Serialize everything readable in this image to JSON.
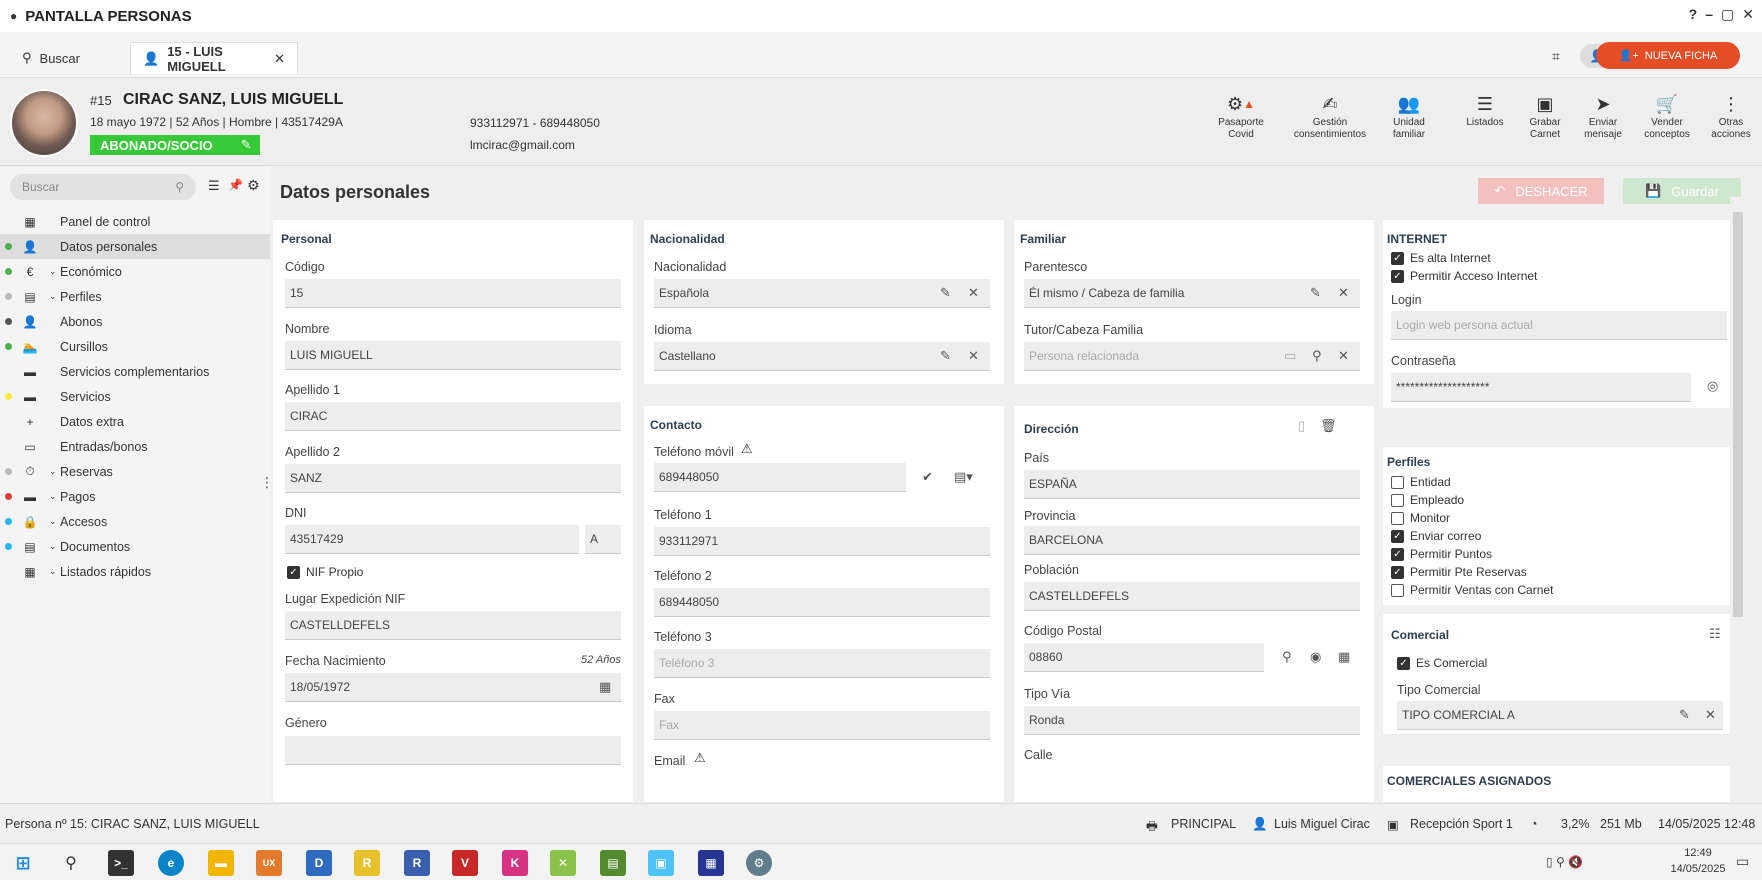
{
  "window": {
    "title": "PANTALLA PERSONAS",
    "controls": [
      "?",
      "–",
      "▢",
      "✕"
    ]
  },
  "tabs": {
    "search_label": "Buscar",
    "active_label": "15 - LUIS MIGUELL",
    "new_button": "NUEVA FICHA"
  },
  "person": {
    "number": "#15",
    "name": "CIRAC SANZ, LUIS MIGUELL",
    "details": "18 mayo 1972 | 52 Años | Hombre | 43517429A",
    "badge": "ABONADO/SOCIO",
    "phones": "933112971 - 689448050",
    "email": "lmcirac@gmail.com"
  },
  "header_actions": [
    {
      "label": "Pasaporte Covid",
      "icon": "gear-icon"
    },
    {
      "label": "Gestión consentimientos",
      "icon": "signature-icon"
    },
    {
      "label": "Unidad familiar",
      "icon": "family-icon"
    },
    {
      "label": "Listados",
      "icon": "list-icon"
    },
    {
      "label": "Grabar Carnet",
      "icon": "card-icon"
    },
    {
      "label": "Enviar mensaje",
      "icon": "send-icon"
    },
    {
      "label": "Vender conceptos",
      "icon": "sell-icon"
    },
    {
      "label": "Otras acciones",
      "icon": "more-icon"
    }
  ],
  "sidebar": {
    "search_placeholder": "Buscar",
    "items": [
      {
        "label": "Panel de control",
        "dot": "",
        "icon": "▦"
      },
      {
        "label": "Datos personales",
        "dot": "#4caf50",
        "icon": "👤"
      },
      {
        "label": "Económico",
        "dot": "#4caf50",
        "icon": "€"
      },
      {
        "label": "Perfiles",
        "dot": "#bbb",
        "icon": "▤"
      },
      {
        "label": "Abonos",
        "dot": "#555",
        "icon": "👤"
      },
      {
        "label": "Cursillos",
        "dot": "#4caf50",
        "icon": "🏊"
      },
      {
        "label": "Servicios complementarios",
        "dot": "",
        "icon": "▬"
      },
      {
        "label": "Servicios",
        "dot": "#ffeb3b",
        "icon": "▬"
      },
      {
        "label": "Datos extra",
        "dot": "",
        "icon": "+"
      },
      {
        "label": "Entradas/bonos",
        "dot": "",
        "icon": "▭"
      },
      {
        "label": "Reservas",
        "dot": "#bbb",
        "icon": "⏱"
      },
      {
        "label": "Pagos",
        "dot": "#e53935",
        "icon": "▬"
      },
      {
        "label": "Accesos",
        "dot": "#29b6f6",
        "icon": "🔒"
      },
      {
        "label": "Documentos",
        "dot": "#29b6f6",
        "icon": "▤"
      },
      {
        "label": "Listados rápidos",
        "dot": "",
        "icon": "▦"
      }
    ]
  },
  "main": {
    "title": "Datos personales",
    "undo_label": "DESHACER",
    "save_label": "Guardar",
    "personal": {
      "title": "Personal",
      "codigo_label": "Código",
      "codigo": "15",
      "nombre_label": "Nombre",
      "nombre": "LUIS MIGUELL",
      "ap1_label": "Apellido 1",
      "ap1": "CIRAC",
      "ap2_label": "Apellido 2",
      "ap2": "SANZ",
      "dni_label": "DNI",
      "dni": "43517429",
      "dni_letter": "A",
      "nif_propio": "NIF Propio",
      "lugar_label": "Lugar Expedición NIF",
      "lugar": "CASTELLDEFELS",
      "fecha_label": "Fecha Nacimiento",
      "edad": "52 Años",
      "fecha": "18/05/1972",
      "genero_label": "Género"
    },
    "nacionalidad": {
      "title": "Nacionalidad",
      "nac_label": "Nacionalidad",
      "nac": "Española",
      "idioma_label": "Idioma",
      "idioma": "Castellano"
    },
    "contacto": {
      "title": "Contacto",
      "movil_label": "Teléfono móvil",
      "movil": "689448050",
      "t1_label": "Teléfono 1",
      "t1": "933112971",
      "t2_label": "Teléfono 2",
      "t2": "689448050",
      "t3_label": "Teléfono 3",
      "t3_ph": "Teléfono 3",
      "fax_label": "Fax",
      "fax_ph": "Fax",
      "email_label": "Email"
    },
    "familiar": {
      "title": "Familiar",
      "parentesco_label": "Parentesco",
      "parentesco": "Él mismo / Cabeza de familia",
      "tutor_label": "Tutor/Cabeza Familia",
      "tutor_ph": "Persona relacionada"
    },
    "direccion": {
      "title": "Dirección",
      "pais_label": "País",
      "pais": "ESPAÑA",
      "prov_label": "Provincia",
      "prov": "BARCELONA",
      "pob_label": "Población",
      "pob": "CASTELLDEFELS",
      "cp_label": "Código Postal",
      "cp": "08860",
      "via_label": "Tipo Vía",
      "via": "Ronda",
      "calle_label": "Calle"
    },
    "internet": {
      "title": "INTERNET",
      "alta": "Es alta Internet",
      "acceso": "Permitir Acceso Internet",
      "login_label": "Login",
      "login_ph": "Login web persona actual",
      "pass_label": "Contraseña",
      "pass": "********************"
    },
    "perfiles": {
      "title": "Perfiles",
      "items": [
        {
          "label": "Entidad",
          "checked": false
        },
        {
          "label": "Empleado",
          "checked": false
        },
        {
          "label": "Monitor",
          "checked": false
        },
        {
          "label": "Enviar correo",
          "checked": true
        },
        {
          "label": "Permitir Puntos",
          "checked": true
        },
        {
          "label": "Permitir Pte Reservas",
          "checked": true
        },
        {
          "label": "Permitir Ventas con Carnet",
          "checked": false
        }
      ]
    },
    "comercial": {
      "title": "Comercial",
      "es_comercial": "Es Comercial",
      "tipo_label": "Tipo Comercial",
      "tipo": "TIPO COMERCIAL A"
    },
    "asignados_title": "COMERCIALES ASIGNADOS"
  },
  "statusbar": {
    "left": "Persona nº 15: CIRAC SANZ, LUIS MIGUELL",
    "branch": "PRINCIPAL",
    "user": "Luis Miguel Cirac",
    "desk": "Recepción Sport 1",
    "cpu": "3,2%",
    "mem": "251 Mb",
    "datetime": "14/05/2025 12:48"
  },
  "taskbar": {
    "time": "12:49",
    "date": "14/05/2025"
  }
}
